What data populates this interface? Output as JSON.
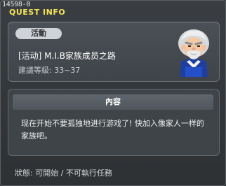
{
  "window": {
    "id_label": "14598-0",
    "title": "QUEST INFO"
  },
  "quest": {
    "badge": "活動",
    "name": "[活动] M.I.B家族成员之路",
    "level": "建議等級: 33~37",
    "portrait_icon": "old-man-npc-icon"
  },
  "content": {
    "header": "內容",
    "description": "现在开始不要孤独地进行游戏了! 快加入像家人一样的家族吧。"
  },
  "status": {
    "text": "狀態: 可開始 / 不可執行任務"
  },
  "colors": {
    "title": "#f2e55a",
    "background": "#2b2e31"
  }
}
